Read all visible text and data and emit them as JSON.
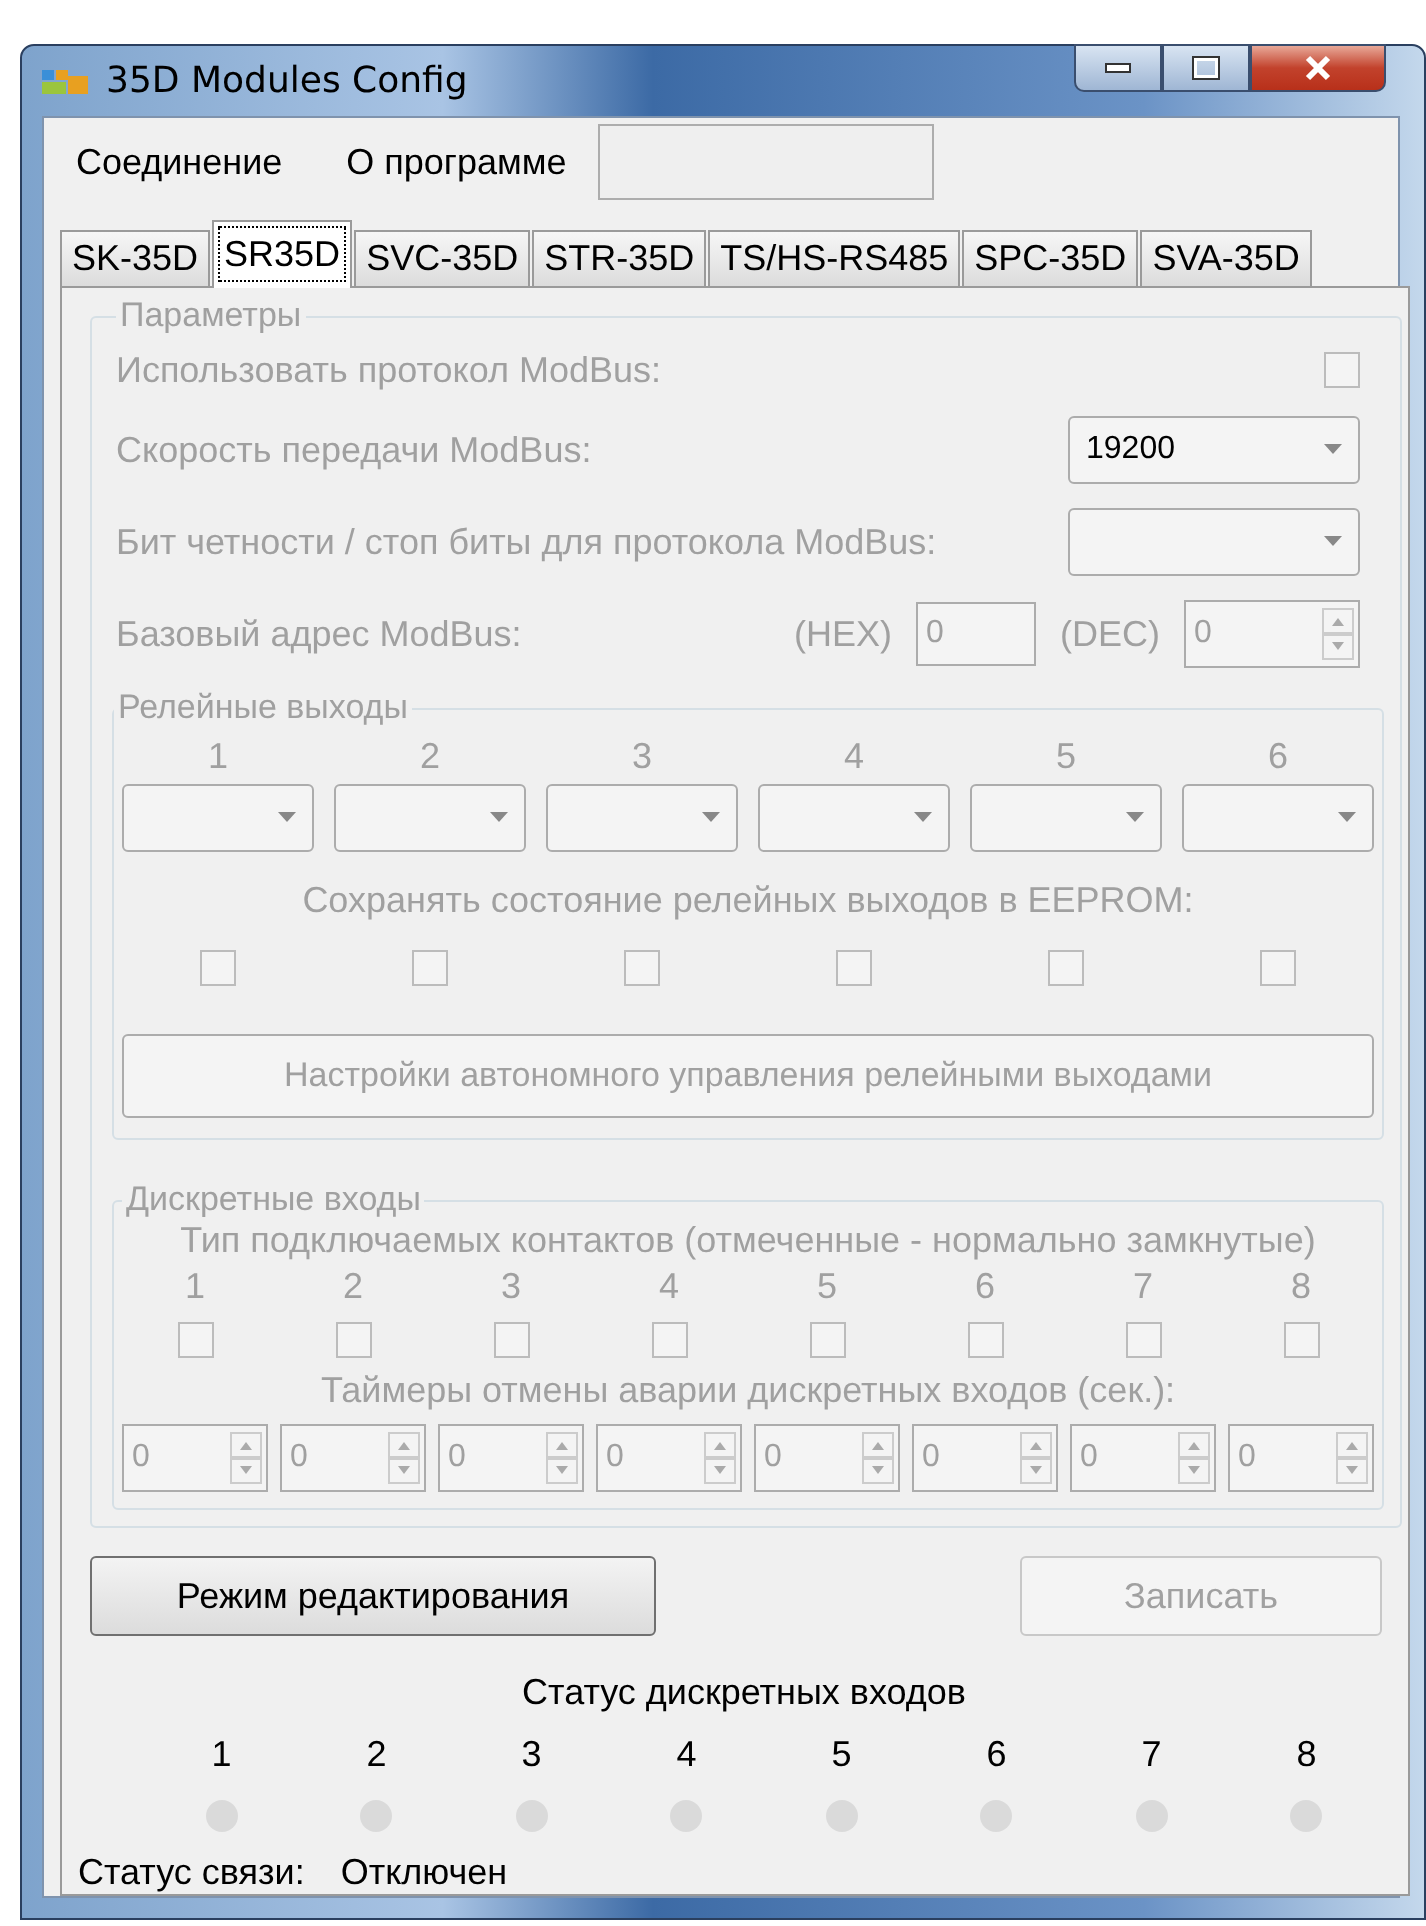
{
  "window": {
    "title": "35D Modules Config"
  },
  "menu": [
    {
      "label": "Соединение"
    },
    {
      "label": "О программе"
    }
  ],
  "tabs": [
    {
      "label": "SK-35D",
      "selected": false
    },
    {
      "label": "SR35D",
      "selected": true
    },
    {
      "label": "SVC-35D",
      "selected": false
    },
    {
      "label": "STR-35D",
      "selected": false
    },
    {
      "label": "TS/HS-RS485",
      "selected": false
    },
    {
      "label": "SPC-35D",
      "selected": false
    },
    {
      "label": "SVA-35D",
      "selected": false
    }
  ],
  "parameters": {
    "title": "Параметры",
    "disabled": true,
    "use_modbus": {
      "label": "Использовать  протокол ModBus:",
      "checked": false
    },
    "baud": {
      "label": "Скорость передачи ModBus:",
      "value": "19200"
    },
    "parity": {
      "label": "Бит четности / стоп биты для протокола ModBus:"
    },
    "address": {
      "label": "Базовый адрес ModBus:",
      "hex_label": "(HEX)",
      "hex_value": "0",
      "dec_label": "(DEC)",
      "dec_value": "0"
    },
    "relays": {
      "title": "Релейные выходы",
      "save_label": "Сохранять состояние релейных выходов в EEPROM:",
      "settings_button": "Настройки автономного управления релейными выходами",
      "outputs": [
        {
          "label": "1",
          "save_checked": false
        },
        {
          "label": "2",
          "save_checked": false
        },
        {
          "label": "3",
          "save_checked": false
        },
        {
          "label": "4",
          "save_checked": false
        },
        {
          "label": "5",
          "save_checked": false
        },
        {
          "label": "6",
          "save_checked": false
        }
      ]
    },
    "inputs": {
      "title": "Дискретные входы",
      "type_label": "Тип подключаемых контактов (отмеченные - нормально замкнутые)",
      "timer_label": "Таймеры отмены аварии дискретных входов (сек.):",
      "channels": [
        {
          "label": "1",
          "normally_closed": false,
          "timer": "0"
        },
        {
          "label": "2",
          "normally_closed": false,
          "timer": "0"
        },
        {
          "label": "3",
          "normally_closed": false,
          "timer": "0"
        },
        {
          "label": "4",
          "normally_closed": false,
          "timer": "0"
        },
        {
          "label": "5",
          "normally_closed": false,
          "timer": "0"
        },
        {
          "label": "6",
          "normally_closed": false,
          "timer": "0"
        },
        {
          "label": "7",
          "normally_closed": false,
          "timer": "0"
        },
        {
          "label": "8",
          "normally_closed": false,
          "timer": "0"
        }
      ]
    }
  },
  "buttons": [
    {
      "label": "Режим редактирования",
      "disabled": false
    },
    {
      "label": "Записать",
      "disabled": true
    }
  ],
  "input_status": {
    "title": "Статус дискретных входов",
    "channels": [
      {
        "label": "1",
        "on": false
      },
      {
        "label": "2",
        "on": false
      },
      {
        "label": "3",
        "on": false
      },
      {
        "label": "4",
        "on": false
      },
      {
        "label": "5",
        "on": false
      },
      {
        "label": "6",
        "on": false
      },
      {
        "label": "7",
        "on": false
      },
      {
        "label": "8",
        "on": false
      }
    ]
  },
  "connection": {
    "label": "Статус связи:",
    "value": "Отключен"
  }
}
